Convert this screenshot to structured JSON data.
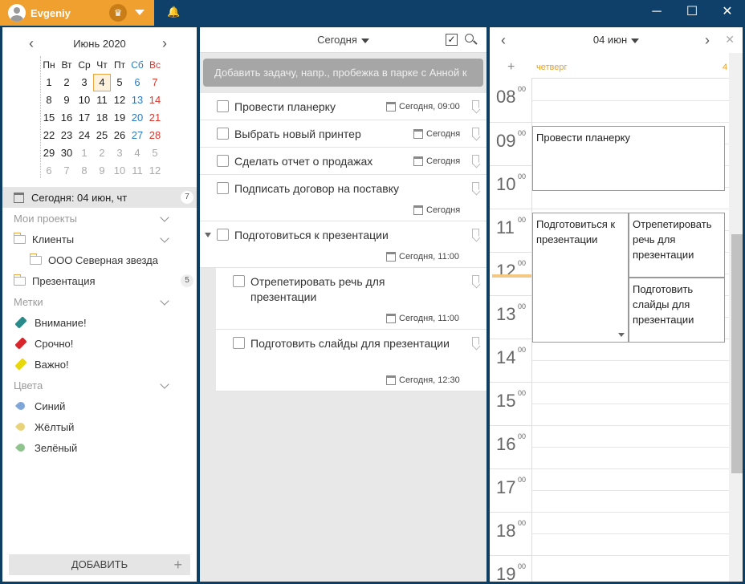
{
  "titlebar": {
    "user_name": "Evgeniy",
    "window_controls": [
      "minimize-icon",
      "maximize-icon",
      "close-icon"
    ]
  },
  "mini_calendar": {
    "title": "Июнь 2020",
    "weekdays": [
      "Пн",
      "Вт",
      "Ср",
      "Чт",
      "Пт",
      "Сб",
      "Вс"
    ],
    "weeks": [
      [
        "1",
        "2",
        "3",
        "4",
        "5",
        "6",
        "7"
      ],
      [
        "8",
        "9",
        "10",
        "11",
        "12",
        "13",
        "14"
      ],
      [
        "15",
        "16",
        "17",
        "18",
        "19",
        "20",
        "21"
      ],
      [
        "22",
        "23",
        "24",
        "25",
        "26",
        "27",
        "28"
      ],
      [
        "29",
        "30",
        "1",
        "2",
        "3",
        "4",
        "5"
      ],
      [
        "6",
        "7",
        "8",
        "9",
        "10",
        "11",
        "12"
      ]
    ],
    "today": "4"
  },
  "sidebar": {
    "today_label": "Сегодня: 04 июн, чт",
    "today_count": "7",
    "projects_title": "Мои проекты",
    "project_clients": "Клиенты",
    "project_sub": "ООО Северная звезда",
    "project_presentation": "Презентация",
    "presentation_count": "5",
    "tags_title": "Метки",
    "tags": [
      {
        "label": "Внимание!",
        "color": "#2a8a8a"
      },
      {
        "label": "Срочно!",
        "color": "#d8262b"
      },
      {
        "label": "Важно!",
        "color": "#e8d80b"
      }
    ],
    "colors_title": "Цвета",
    "colors": [
      {
        "label": "Синий",
        "color": "#7fa6d9"
      },
      {
        "label": "Жёлтый",
        "color": "#e8d27a"
      },
      {
        "label": "Зелёный",
        "color": "#8fc48f"
      }
    ],
    "add_button": "ДОБАВИТЬ"
  },
  "tasks_panel": {
    "title": "Сегодня",
    "add_placeholder": "Добавить задачу, напр., пробежка в парке с Анной к",
    "tasks": [
      {
        "text": "Провести планерку",
        "due": "Сегодня, 09:00"
      },
      {
        "text": "Выбрать новый принтер",
        "due": "Сегодня"
      },
      {
        "text": "Сделать отчет о продажах",
        "due": "Сегодня"
      },
      {
        "text": "Подписать договор на поставку",
        "due": "Сегодня"
      },
      {
        "text": "Подготовиться к презентации",
        "due": "Сегодня, 11:00"
      },
      {
        "text": "Отрепетировать речь для презентации",
        "due": "Сегодня, 11:00"
      },
      {
        "text": "Подготовить слайды для презентации",
        "due": "Сегодня, 12:30"
      }
    ]
  },
  "day_view": {
    "title": "04 июн",
    "day_name": "четверг",
    "day_number": "4",
    "hours": [
      "08",
      "09",
      "10",
      "11",
      "12",
      "13",
      "14",
      "15",
      "16",
      "17",
      "18",
      "19"
    ],
    "minutes": "00",
    "events": [
      {
        "text": "Провести планерку"
      },
      {
        "text": "Подготовиться к презентации"
      },
      {
        "text": "Отрепетировать речь для презентации"
      },
      {
        "text": "Подготовить слайды для презентации"
      }
    ]
  }
}
